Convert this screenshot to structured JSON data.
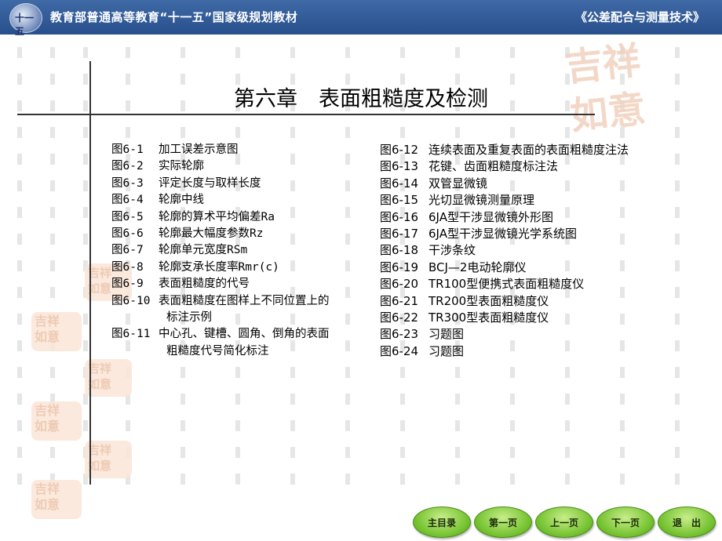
{
  "header": {
    "logo_text": "十一五",
    "left": "教育部普通高等教育“十一五”国家级规划教材",
    "right": "《公差配合与测量技术》"
  },
  "title": "第六章　表面粗糙度及检测",
  "left_items": [
    {
      "fig": "图6-1",
      "text": "加工误差示意图"
    },
    {
      "fig": "图6-2",
      "text": "实际轮廓"
    },
    {
      "fig": "图6-3",
      "text": "评定长度与取样长度"
    },
    {
      "fig": "图6-4",
      "text": "轮廓中线"
    },
    {
      "fig": "图6-5",
      "text": "轮廓的算术平均偏差Ra"
    },
    {
      "fig": "图6-6",
      "text": "轮廓最大幅度参数Rz"
    },
    {
      "fig": "图6-7",
      "text": "轮廓单元宽度RSm"
    },
    {
      "fig": "图6-8",
      "text": "轮廓支承长度率Rmr(c)"
    },
    {
      "fig": "图6-9",
      "text": "表面粗糙度的代号"
    },
    {
      "fig": "图6-10",
      "text": "表面粗糙度在图样上不同位置上的",
      "cont": "标注示例"
    },
    {
      "fig": "图6-11",
      "text": "中心孔、键槽、圆角、倒角的表面",
      "cont": "粗糙度代号简化标注"
    }
  ],
  "right_items": [
    {
      "fig": "图6-12",
      "text": "连续表面及重复表面的表面粗糙度注法"
    },
    {
      "fig": "图6-13",
      "text": "花键、齿面粗糙度标注法"
    },
    {
      "fig": "图6-14",
      "text": "双管显微镜"
    },
    {
      "fig": "图6-15",
      "text": "光切显微镜测量原理"
    },
    {
      "fig": "图6-16",
      "text": "6JA型干涉显微镜外形图"
    },
    {
      "fig": "图6-17",
      "text": "6JA型干涉显微镜光学系统图"
    },
    {
      "fig": "图6-18",
      "text": "干涉条纹"
    },
    {
      "fig": "图6-19",
      "text": "BCJ—2电动轮廓仪"
    },
    {
      "fig": "图6-20",
      "text": "TR100型便携式表面粗糙度仪"
    },
    {
      "fig": "图6-21",
      "text": "TR200型表面粗糙度仪"
    },
    {
      "fig": "图6-22",
      "text": "TR300型表面粗糙度仪"
    },
    {
      "fig": "图6-23",
      "text": "习题图"
    },
    {
      "fig": "图6-24",
      "text": "习题图"
    }
  ],
  "nav": {
    "home": "主目录",
    "first": "第一页",
    "prev": "上一页",
    "next": "下一页",
    "exit": "退　出"
  },
  "colors": {
    "header_bg": "#2f5a98",
    "nav_button": "#7cc83a",
    "seal": "#ecc3a8"
  }
}
